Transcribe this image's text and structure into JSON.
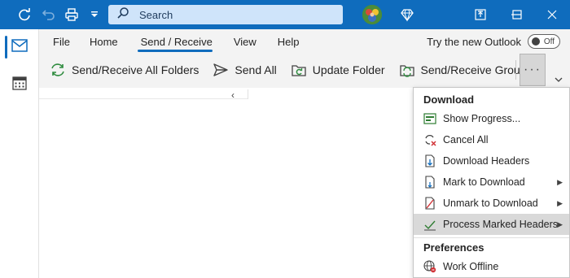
{
  "titlebar": {
    "search_placeholder": "Search",
    "colors": {
      "bar": "#0f6cbd",
      "search_bg": "#cfe4fa"
    }
  },
  "tabs": [
    {
      "label": "File"
    },
    {
      "label": "Home"
    },
    {
      "label": "Send / Receive",
      "active": true
    },
    {
      "label": "View"
    },
    {
      "label": "Help"
    }
  ],
  "try_new": {
    "label": "Try the new Outlook",
    "toggle": "Off"
  },
  "ribbon": {
    "send_receive_all": "Send/Receive All Folders",
    "send_all": "Send All",
    "update_folder": "Update Folder",
    "send_receive_groups": "Send/Receive Groups"
  },
  "menu": {
    "download_header": "Download",
    "items": [
      {
        "label": "Show Progress...",
        "icon": "progress-icon"
      },
      {
        "label": "Cancel All",
        "icon": "cancel-sync-icon"
      },
      {
        "label": "Download Headers",
        "icon": "download-headers-icon"
      },
      {
        "label": "Mark to Download",
        "icon": "mark-download-icon",
        "submenu": true
      },
      {
        "label": "Unmark to Download",
        "icon": "unmark-download-icon",
        "submenu": true
      },
      {
        "label": "Process Marked Headers",
        "icon": "process-headers-icon",
        "submenu": true,
        "highlighted": true
      }
    ],
    "preferences_header": "Preferences",
    "work_offline": "Work Offline"
  }
}
